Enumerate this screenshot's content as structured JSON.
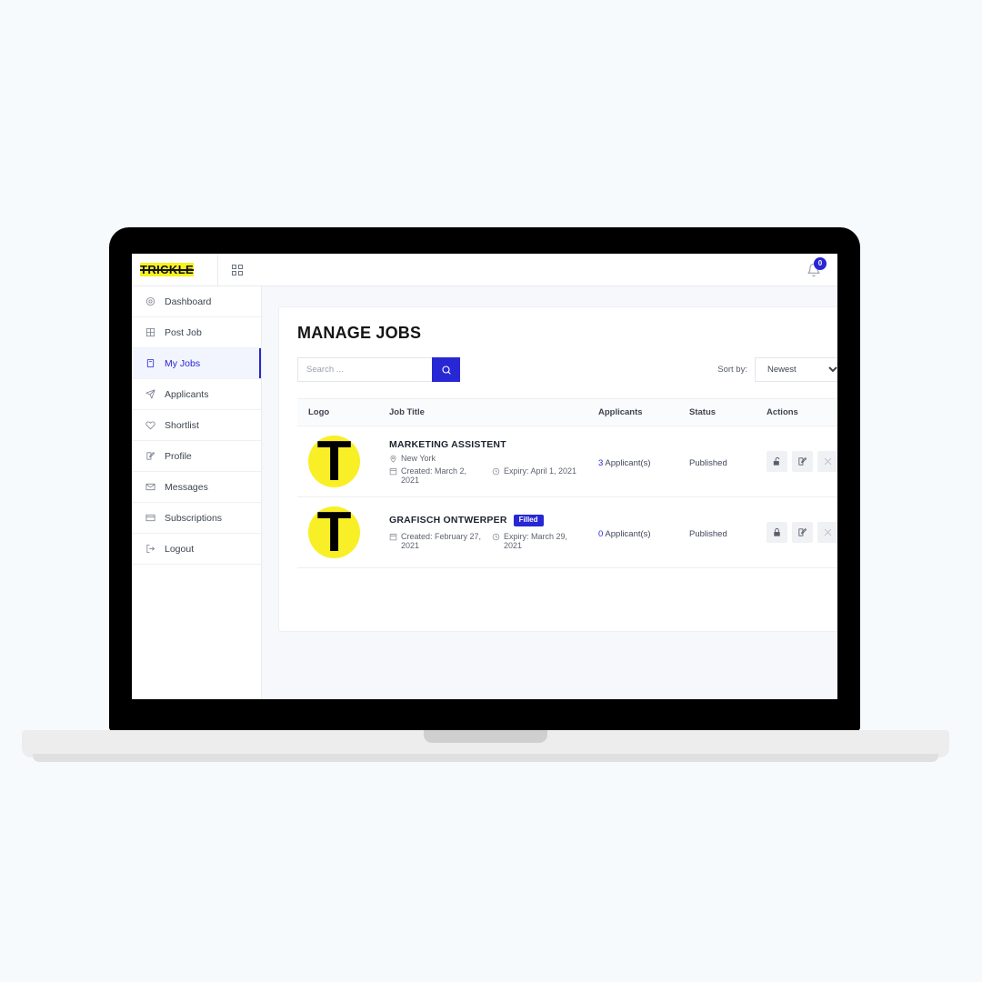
{
  "theme": {
    "page_background": "#f6fafd",
    "accent_blue": "#2727d4",
    "brand_yellow": "#f7f21e",
    "logo_yellow": "#f9ef26"
  },
  "topbar": {
    "brand": "TRICKLE",
    "grid_icon": "grid-2x2-icon",
    "notification": {
      "icon": "bell-icon",
      "badge_count": "0"
    }
  },
  "sidebar": {
    "items": [
      {
        "label": "Dashboard",
        "icon": "at-circle-icon",
        "active": false
      },
      {
        "label": "Post Job",
        "icon": "plus-square-icon",
        "active": false
      },
      {
        "label": "My Jobs",
        "icon": "book-icon",
        "active": true
      },
      {
        "label": "Applicants",
        "icon": "paper-plane-icon",
        "active": false
      },
      {
        "label": "Shortlist",
        "icon": "heart-icon",
        "active": false
      },
      {
        "label": "Profile",
        "icon": "edit-square-icon",
        "active": false
      },
      {
        "label": "Messages",
        "icon": "envelope-icon",
        "active": false
      },
      {
        "label": "Subscriptions",
        "icon": "credit-card-icon",
        "active": false
      },
      {
        "label": "Logout",
        "icon": "sign-out-icon",
        "active": false
      }
    ]
  },
  "main": {
    "page_title": "MANAGE JOBS",
    "search": {
      "placeholder": "Search ...",
      "value": "",
      "button_icon": "search-icon"
    },
    "sort": {
      "label": "Sort by:",
      "selected": "Newest",
      "options": [
        "Newest"
      ]
    },
    "table": {
      "columns": [
        "Logo",
        "Job Title",
        "Applicants",
        "Status",
        "Actions"
      ],
      "rows": [
        {
          "logo_letter": "T",
          "title": "MARKETING ASSISTENT",
          "badge": null,
          "location": "New York",
          "location_icon": "map-pin-icon",
          "created": "Created: March 2, 2021",
          "created_icon": "calendar-icon",
          "expiry": "Expiry: April 1, 2021",
          "expiry_icon": "clock-icon",
          "applicants_count": "3",
          "applicants_suffix": " Applicant(s)",
          "status": "Published",
          "actions": [
            {
              "icon": "unlock-icon",
              "muted": false
            },
            {
              "icon": "edit-square-icon",
              "muted": false
            },
            {
              "icon": "close-x-icon",
              "muted": true
            }
          ]
        },
        {
          "logo_letter": "T",
          "title": "GRAFISCH ONTWERPER",
          "badge": "Filled",
          "location": null,
          "location_icon": null,
          "created": "Created: February 27, 2021",
          "created_icon": "calendar-icon",
          "expiry": "Expiry: March 29, 2021",
          "expiry_icon": "clock-icon",
          "applicants_count": "0",
          "applicants_suffix": " Applicant(s)",
          "status": "Published",
          "actions": [
            {
              "icon": "lock-icon",
              "muted": false
            },
            {
              "icon": "edit-square-icon",
              "muted": false
            },
            {
              "icon": "close-x-icon",
              "muted": true
            }
          ]
        }
      ]
    }
  }
}
